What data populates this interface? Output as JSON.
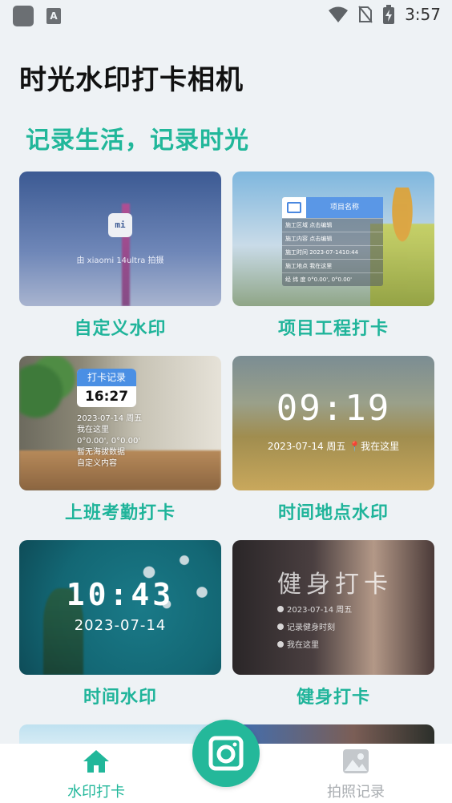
{
  "status_bar": {
    "time": "3:57",
    "badge_letter": "A"
  },
  "header": {
    "title": "时光水印打卡相机",
    "slogan": "记录生活，记录时光"
  },
  "colors": {
    "accent": "#21b79a",
    "background": "#eef2f5",
    "inactive": "#a9adb1"
  },
  "cards": [
    {
      "label": "自定义水印",
      "thumb": {
        "logo": "mi",
        "caption": "由 xiaomi 14ultra 拍摄"
      }
    },
    {
      "label": "项目工程打卡",
      "thumb": {
        "title": "项目名称",
        "rows": [
          "施工区域  点击编辑",
          "施工内容  点击编辑",
          "施工时间  2023-07-1410:44",
          "施工地点  我在这里",
          "经  纬  度  0°0.00', 0°0.00'"
        ]
      }
    },
    {
      "label": "上班考勤打卡",
      "thumb": {
        "badge_title": "打卡记录",
        "badge_time": "16:27",
        "lines": [
          "2023-07-14 周五",
          "我在这里",
          "0°0.00', 0°0.00'",
          "暂无海拔数据",
          "自定义内容"
        ]
      }
    },
    {
      "label": "时间地点水印",
      "thumb": {
        "time": "09:19",
        "meta": "2023-07-14 周五 📍我在这里"
      }
    },
    {
      "label": "时间水印",
      "thumb": {
        "time": "10:43",
        "date": "2023-07-14"
      }
    },
    {
      "label": "健身打卡",
      "thumb": {
        "title": "健身打卡",
        "rows": [
          "2023-07-14 周五",
          "记录健身时刻",
          "我在这里"
        ]
      }
    }
  ],
  "nav": {
    "home_label": "水印打卡",
    "records_label": "拍照记录",
    "home_icon": "home-icon",
    "camera_icon": "camera-icon",
    "records_icon": "photo-icon"
  }
}
